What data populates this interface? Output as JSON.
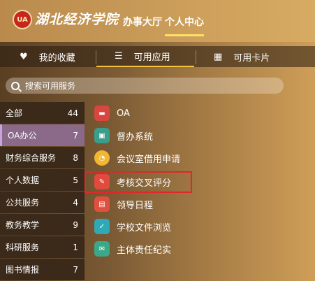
{
  "header": {
    "logo_text": "UA",
    "school_name": "湖北经济学院",
    "nav": [
      "办事大厅",
      "个人中心"
    ],
    "active_nav": "个人中心"
  },
  "tabs": [
    {
      "label": "我的收藏",
      "icon": "heart-icon"
    },
    {
      "label": "可用应用",
      "icon": "list-icon"
    },
    {
      "label": "可用卡片",
      "icon": "grid-icon"
    }
  ],
  "search": {
    "placeholder": "搜索可用服务"
  },
  "categories": [
    {
      "label": "全部",
      "count": "44"
    },
    {
      "label": "OA办公",
      "count": "7"
    },
    {
      "label": "财务综合服务",
      "count": "8"
    },
    {
      "label": "个人数据",
      "count": "5"
    },
    {
      "label": "公共服务",
      "count": "4"
    },
    {
      "label": "教务教学",
      "count": "9"
    },
    {
      "label": "科研服务",
      "count": "1"
    },
    {
      "label": "图书情报",
      "count": "7"
    }
  ],
  "apps": [
    {
      "label": "OA",
      "icon": "oa-icon",
      "color": "#d9463f"
    },
    {
      "label": "督办系统",
      "icon": "supervision-icon",
      "color": "#3a9e8a"
    },
    {
      "label": "会议室借用申请",
      "icon": "meeting-room-icon",
      "color": "#f2b632"
    },
    {
      "label": "考核交叉评分",
      "icon": "assessment-icon",
      "color": "#e24a3d"
    },
    {
      "label": "领导日程",
      "icon": "schedule-icon",
      "color": "#e0503f"
    },
    {
      "label": "学校文件浏览",
      "icon": "file-browse-icon",
      "color": "#2fa9b8"
    },
    {
      "label": "主体责任纪实",
      "icon": "responsibility-icon",
      "color": "#3ca88a"
    }
  ],
  "highlight_color": "#e0272a"
}
